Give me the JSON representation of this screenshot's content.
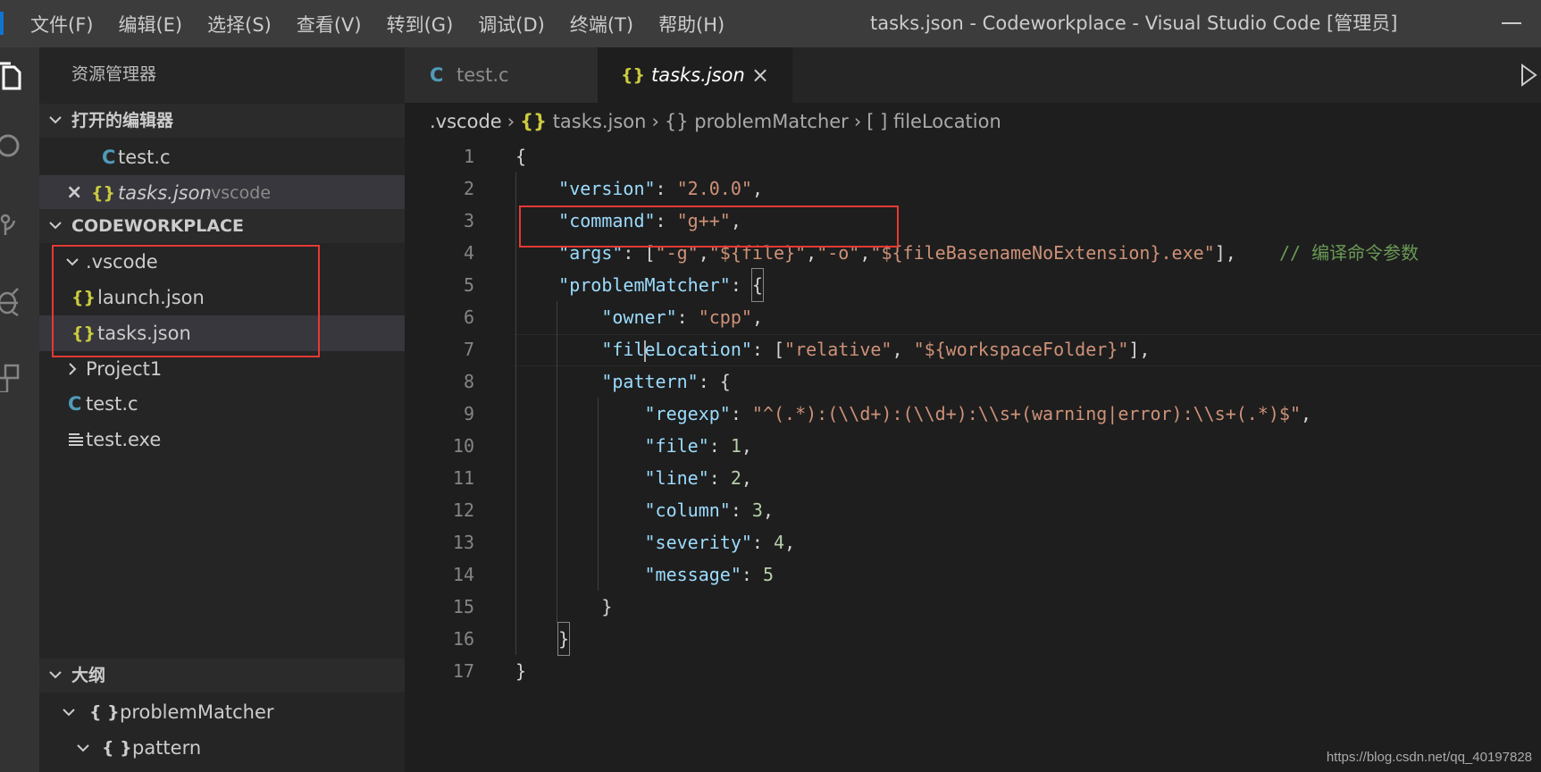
{
  "titlebar": {
    "menu": [
      "文件(F)",
      "编辑(E)",
      "选择(S)",
      "查看(V)",
      "转到(G)",
      "调试(D)",
      "终端(T)",
      "帮助(H)"
    ],
    "window_title": "tasks.json - Codeworkplace - Visual Studio Code [管理员]"
  },
  "sidebar": {
    "title": "资源管理器",
    "open_editors": {
      "header": "打开的编辑器",
      "items": [
        {
          "icon": "C",
          "name": "test.c"
        },
        {
          "icon": "{}",
          "name": "tasks.json",
          "folder": ".vscode",
          "close": "×"
        }
      ]
    },
    "workspace": {
      "header": "CODEWORKPLACE",
      "folder_vscode": ".vscode",
      "launch": "launch.json",
      "tasks": "tasks.json",
      "project": "Project1",
      "testc": "test.c",
      "testexe": "test.exe"
    },
    "outline": {
      "header": "大纲",
      "item1": "problemMatcher",
      "item2": "pattern"
    },
    "icons": {
      "c": "C",
      "json": "{}",
      "brace": "{ }"
    }
  },
  "tabs": [
    {
      "icon": "C",
      "label": "test.c"
    },
    {
      "icon": "{}",
      "label": "tasks.json",
      "close": "×"
    }
  ],
  "breadcrumb": {
    "items": [
      ".vscode",
      "tasks.json",
      "problemMatcher",
      "fileLocation"
    ],
    "json_icon": "{}",
    "obj_icon": "{}",
    "arr_icon": "[ ]"
  },
  "editor": {
    "line_numbers": [
      "1",
      "2",
      "3",
      "4",
      "5",
      "6",
      "7",
      "8",
      "9",
      "10",
      "11",
      "12",
      "13",
      "14",
      "15",
      "16",
      "17"
    ],
    "comment": "// 编译命令参数",
    "values": {
      "version": "\"2.0.0\"",
      "command": "\"g++\"",
      "args": [
        "\"-g\"",
        "\"${file}\"",
        "\"-o\"",
        "\"${fileBasenameNoExtension}.exe\""
      ],
      "owner": "\"cpp\"",
      "fileLocation": [
        "\"relative\"",
        "\"${workspaceFolder}\""
      ],
      "regexp": "\"^(.*):(\\\\d+):(\\\\d+):\\\\s+(warning|error):\\\\s+(.*)$\"",
      "file": "1",
      "line": "2",
      "column": "3",
      "severity": "4",
      "message": "5"
    }
  },
  "watermark": "https://blog.csdn.net/qq_40197828",
  "colors": {
    "accent": "#0e75d1",
    "highlight_box": "#e53935",
    "json_icon": "#cbcb41",
    "c_icon": "#519aba"
  }
}
